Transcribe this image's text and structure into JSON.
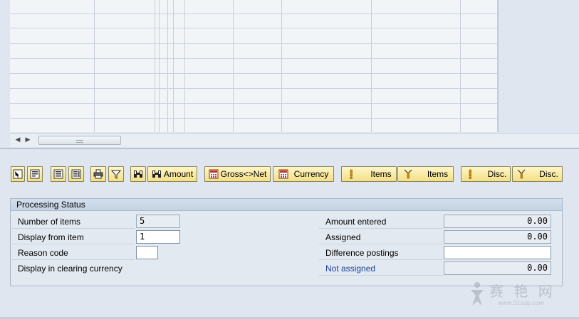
{
  "toolbar": {
    "buttons": [
      {
        "label": "",
        "icon": "select-all-icon"
      },
      {
        "label": "",
        "icon": "deselect-all-icon"
      },
      {
        "label": "",
        "icon": "activate-items-icon"
      },
      {
        "label": "",
        "icon": "deactivate-items-icon"
      },
      {
        "label": "",
        "icon": "print-icon"
      },
      {
        "label": "",
        "icon": "filter-icon"
      },
      {
        "label": "",
        "icon": "find-icon"
      },
      {
        "label": "Amount",
        "icon": "find-next-icon"
      },
      {
        "label": "Gross<>Net",
        "icon": "calc-icon"
      },
      {
        "label": "Currency",
        "icon": "calc-icon"
      },
      {
        "label": "Items",
        "icon": "activate-icon"
      },
      {
        "label": "Items",
        "icon": "deactivate-icon"
      },
      {
        "label": "Disc.",
        "icon": "activate-icon"
      },
      {
        "label": "Disc.",
        "icon": "deactivate-icon"
      }
    ]
  },
  "processing_status": {
    "title": "Processing Status",
    "left": {
      "number_of_items": {
        "label": "Number of items",
        "value": "5"
      },
      "display_from_item": {
        "label": "Display from item",
        "value": "1"
      },
      "reason_code": {
        "label": "Reason code",
        "value": ""
      },
      "display_in_clearing_currency": {
        "label": "Display in clearing currency"
      }
    },
    "right": {
      "amount_entered": {
        "label": "Amount entered",
        "value": "0.00"
      },
      "assigned": {
        "label": "Assigned",
        "value": "0.00"
      },
      "difference_postings": {
        "label": "Difference postings",
        "value": ""
      },
      "not_assigned": {
        "label": "Not assigned",
        "value": "0.00"
      }
    }
  },
  "colors": {
    "background": "#dfe6ef",
    "button": "#f6e59a",
    "link_blue": "#1b3f9e"
  },
  "watermark": {
    "text": "赛 艳 网",
    "url": "www.91sap.com"
  }
}
